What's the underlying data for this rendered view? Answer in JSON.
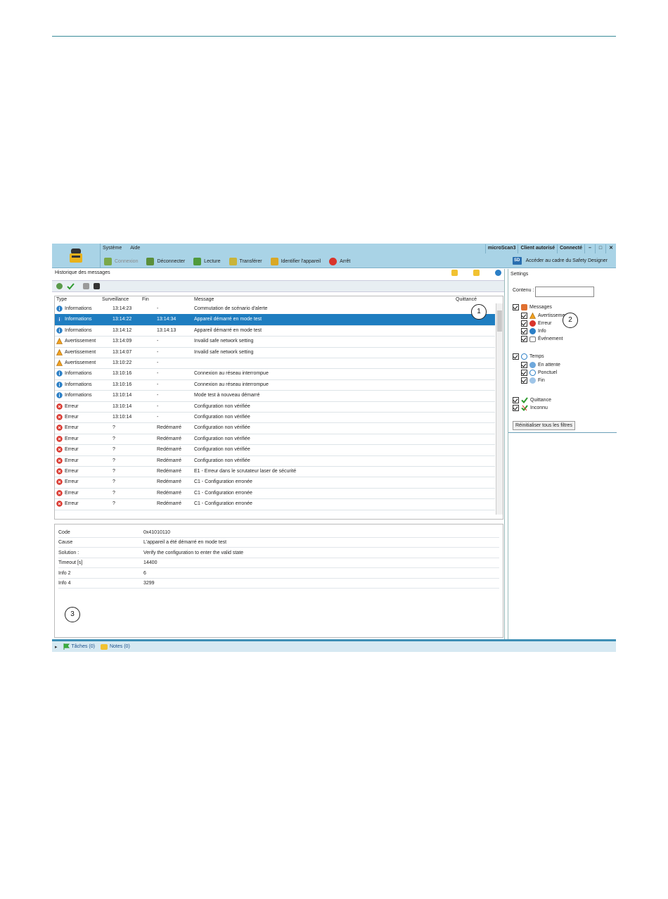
{
  "header": {
    "menu": [
      "Système",
      "Aide"
    ],
    "device": "microScan3",
    "client": "Client autorisé",
    "connection": "Connecté",
    "window_buttons": [
      "–",
      "□",
      "✕"
    ],
    "toolbar": {
      "connect": "Connexion",
      "disconnect": "Déconnecter",
      "read": "Lecture",
      "transfer": "Transférer",
      "identify": "Identifier l'appareil",
      "stop": "Arrêt"
    },
    "sd_badge": "SD",
    "safety_designer_link": "Accéder au cadre du Safety Designer"
  },
  "history": {
    "title": "Historique des messages",
    "columns": {
      "type": "Type",
      "surveillance": "Surveillance",
      "fin": "Fin",
      "message": "Message",
      "quittance": "Quittancé"
    },
    "rows": [
      {
        "icon": "info",
        "type": "Informations",
        "surv": "13:14:23",
        "fin": "-",
        "message": "Commutation de scénario d'alerte"
      },
      {
        "icon": "info",
        "type": "Informations",
        "surv": "13:14:22",
        "fin": "13:14:34",
        "message": "Appareil démarré en mode test",
        "selected": true
      },
      {
        "icon": "info",
        "type": "Informations",
        "surv": "13:14:12",
        "fin": "13:14:13",
        "message": "Appareil démarré en mode test"
      },
      {
        "icon": "warning",
        "type": "Avertissement",
        "surv": "13:14:09",
        "fin": "-",
        "message": "Invalid safe network setting"
      },
      {
        "icon": "warning",
        "type": "Avertissement",
        "surv": "13:14:07",
        "fin": "-",
        "message": "Invalid safe network setting"
      },
      {
        "icon": "warning",
        "type": "Avertissement",
        "surv": "13:10:22",
        "fin": "-",
        "message": ""
      },
      {
        "icon": "info",
        "type": "Informations",
        "surv": "13:10:16",
        "fin": "-",
        "message": "Connexion au réseau interrompue"
      },
      {
        "icon": "info",
        "type": "Informations",
        "surv": "13:10:16",
        "fin": "-",
        "message": "Connexion au réseau interrompue"
      },
      {
        "icon": "info",
        "type": "Informations",
        "surv": "13:10:14",
        "fin": "-",
        "message": "Mode test à nouveau démarré"
      },
      {
        "icon": "error",
        "type": "Erreur",
        "surv": "13:10:14",
        "fin": "-",
        "message": "Configuration non vérifiée"
      },
      {
        "icon": "error",
        "type": "Erreur",
        "surv": "13:10:14",
        "fin": "-",
        "message": "Configuration non vérifiée"
      },
      {
        "icon": "error",
        "type": "Erreur",
        "surv": "?",
        "fin": "Redémarré",
        "message": "Configuration non vérifiée"
      },
      {
        "icon": "error",
        "type": "Erreur",
        "surv": "?",
        "fin": "Redémarré",
        "message": "Configuration non vérifiée"
      },
      {
        "icon": "error",
        "type": "Erreur",
        "surv": "?",
        "fin": "Redémarré",
        "message": "Configuration non vérifiée"
      },
      {
        "icon": "error",
        "type": "Erreur",
        "surv": "?",
        "fin": "Redémarré",
        "message": "Configuration non vérifiée"
      },
      {
        "icon": "error",
        "type": "Erreur",
        "surv": "?",
        "fin": "Redémarré",
        "message": "E1 - Erreur dans le scrutateur laser de sécurité"
      },
      {
        "icon": "error",
        "type": "Erreur",
        "surv": "?",
        "fin": "Redémarré",
        "message": "C1 - Configuration erronée"
      },
      {
        "icon": "error",
        "type": "Erreur",
        "surv": "?",
        "fin": "Redémarré",
        "message": "C1 - Configuration erronée"
      },
      {
        "icon": "error",
        "type": "Erreur",
        "surv": "?",
        "fin": "Redémarré",
        "message": "C1 - Configuration erronée"
      }
    ]
  },
  "details": [
    {
      "label": "Code",
      "value": "0x41010110"
    },
    {
      "label": "Cause",
      "value": "L'appareil a été démarré en mode test"
    },
    {
      "label": "Solution :",
      "value": "Verify the configuration to enter the valid state"
    },
    {
      "label": "Timeout [s]",
      "value": "14400"
    },
    {
      "label": "Info 2",
      "value": "6"
    },
    {
      "label": "Info 4",
      "value": "3299"
    }
  ],
  "settings": {
    "title": "Settings",
    "contenu_label": "Contenu :",
    "contenu_value": "",
    "messages": "Messages",
    "avertissement": "Avertissement",
    "erreur": "Erreur",
    "info": "Info",
    "evenement": "Événement",
    "temps": "Temps",
    "en_attente": "En attente",
    "ponctuel": "Ponctuel",
    "fin": "Fin",
    "quittance": "Quittance",
    "inconnu": "Inconnu",
    "reset": "Réinitialiser tous les filtres"
  },
  "footer": {
    "taches": "Tâches (0)",
    "notes": "Notes (0)"
  },
  "callouts": [
    "1",
    "2",
    "3"
  ],
  "colors": {
    "header_bg": "#a9d3e6",
    "selection": "#1e7dc0",
    "info": "#2b7fc6",
    "warning": "#f0a020",
    "error": "#d9342b",
    "footer_rule": "#3d8fb5"
  }
}
